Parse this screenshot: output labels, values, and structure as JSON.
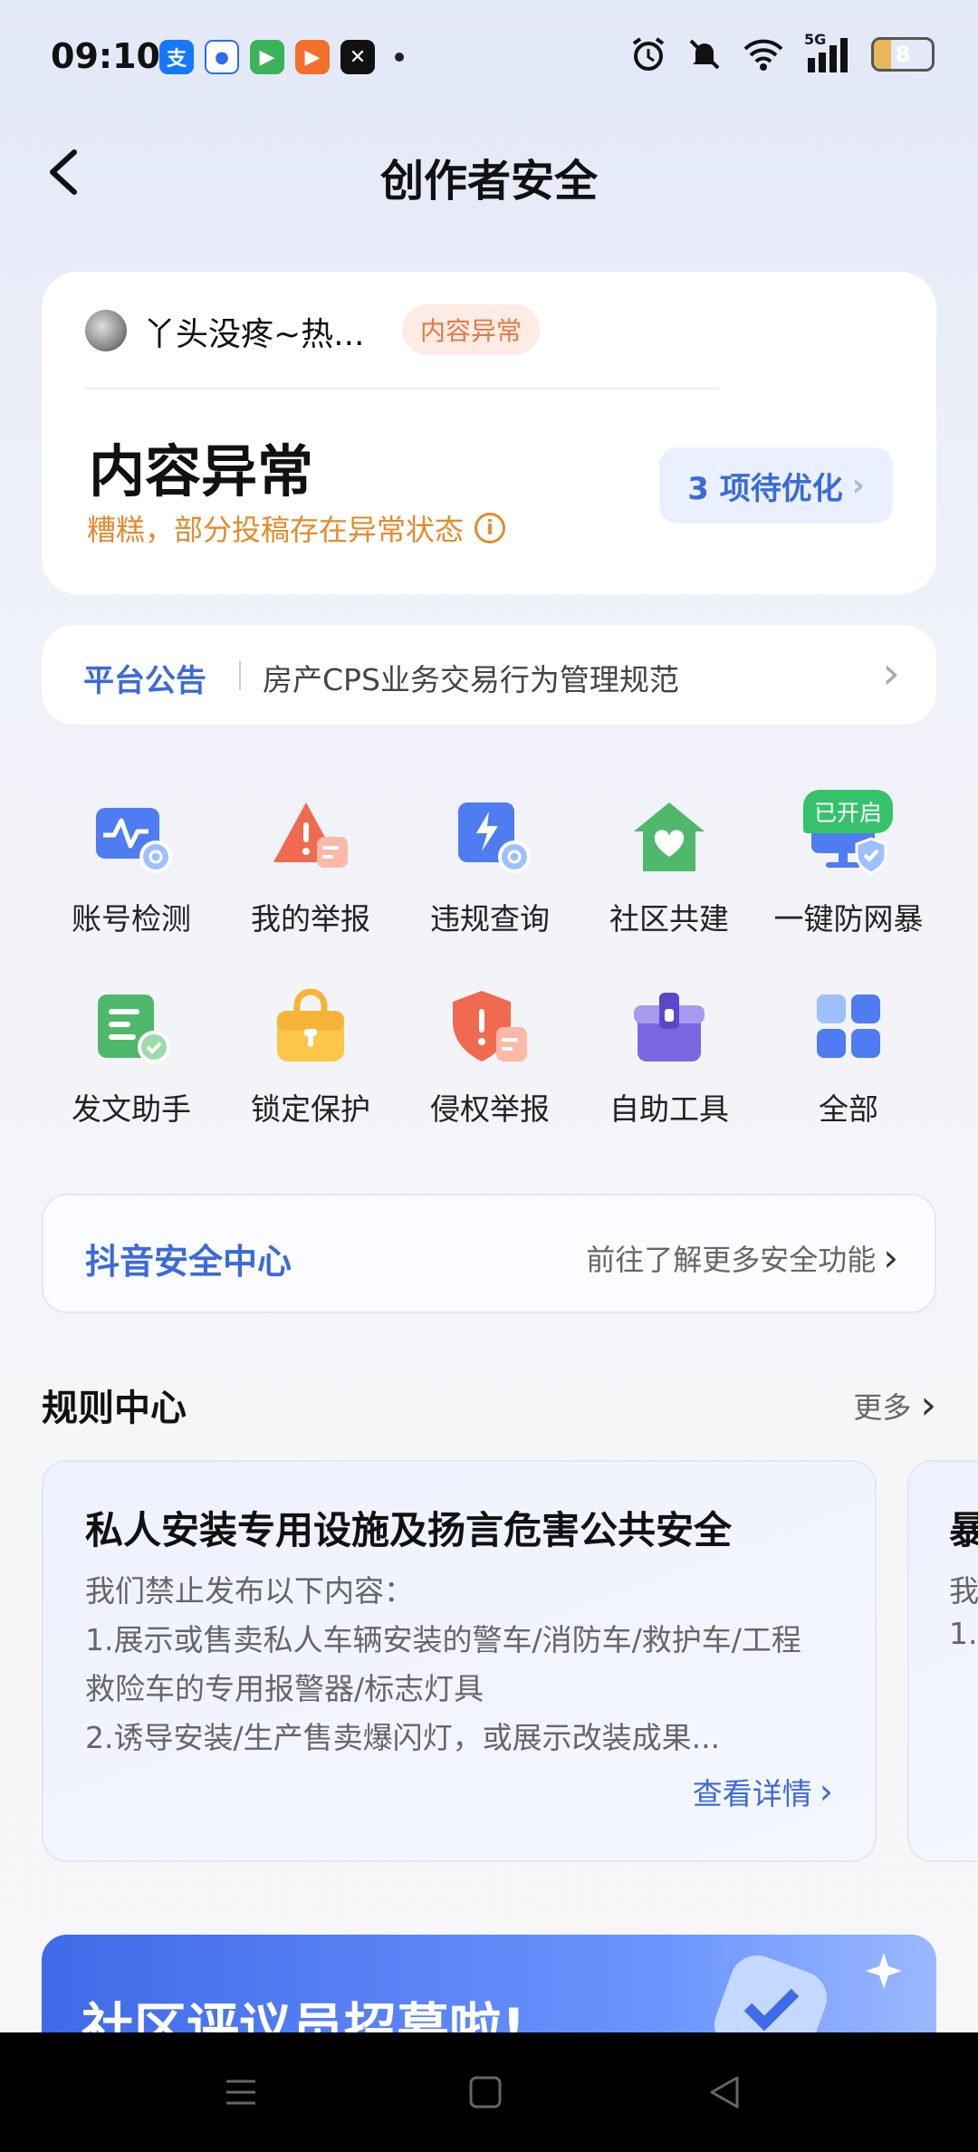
{
  "status_bar": {
    "time": "09:10",
    "apps": [
      {
        "name": "alipay-icon",
        "glyph": "支",
        "color": "#1677ff"
      },
      {
        "name": "baidu-icon",
        "glyph": "🐾",
        "color": "#2d6bf0"
      },
      {
        "name": "video-app-icon",
        "glyph": "▶",
        "color": "#3bb35b"
      },
      {
        "name": "video-app2-icon",
        "glyph": "▶",
        "color": "#f36f2c"
      },
      {
        "name": "capcut-icon",
        "glyph": "✕",
        "color": "#111111"
      }
    ],
    "network": "5G",
    "battery": "8"
  },
  "nav": {
    "title": "创作者安全"
  },
  "account": {
    "username": "丫头没疼~热...",
    "status_pill": "内容异常",
    "status_title": "内容异常",
    "status_desc": "糟糕，部分投稿存在异常状态",
    "optimize_label": "3 项待优化"
  },
  "notice": {
    "label": "平台公告",
    "text": "房产CPS业务交易行为管理规范"
  },
  "tools": [
    {
      "label": "账号检测",
      "icon": "account-check-icon"
    },
    {
      "label": "我的举报",
      "icon": "my-report-icon"
    },
    {
      "label": "违规查询",
      "icon": "violation-query-icon"
    },
    {
      "label": "社区共建",
      "icon": "community-icon"
    },
    {
      "label": "一键防网暴",
      "icon": "anti-bullying-icon",
      "badge": "已开启"
    },
    {
      "label": "发文助手",
      "icon": "post-assistant-icon"
    },
    {
      "label": "锁定保护",
      "icon": "lock-protect-icon"
    },
    {
      "label": "侵权举报",
      "icon": "infringement-report-icon"
    },
    {
      "label": "自助工具",
      "icon": "self-service-icon"
    },
    {
      "label": "全部",
      "icon": "all-grid-icon"
    }
  ],
  "security_center": {
    "title": "抖音安全中心",
    "link": "前往了解更多安全功能"
  },
  "rules": {
    "title": "规则中心",
    "more": "更多",
    "card": {
      "heading": "私人安装专用设施及扬言危害公共安全",
      "lines": [
        "我们禁止发布以下内容：",
        "1.展示或售卖私人车辆安装的警车/消防车/救护车/工程",
        "救险车的专用报警器/标志灯具",
        "2.诱导安装/生产售卖爆闪灯，或展示改装成果..."
      ],
      "detail": "查看详情"
    },
    "card2": {
      "heading": "暴",
      "lines": [
        "我",
        "1."
      ]
    }
  },
  "banner": {
    "text": "社区评议员招募啦!"
  }
}
